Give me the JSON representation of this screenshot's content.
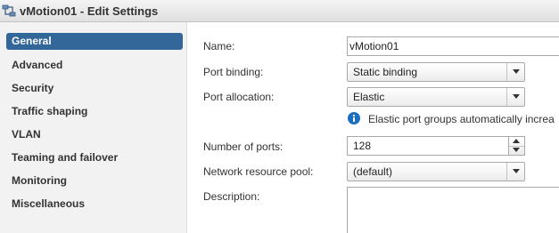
{
  "window": {
    "title": "vMotion01 - Edit Settings"
  },
  "sidebar": {
    "items": [
      {
        "label": "General"
      },
      {
        "label": "Advanced"
      },
      {
        "label": "Security"
      },
      {
        "label": "Traffic shaping"
      },
      {
        "label": "VLAN"
      },
      {
        "label": "Teaming and failover"
      },
      {
        "label": "Monitoring"
      },
      {
        "label": "Miscellaneous"
      }
    ]
  },
  "form": {
    "name_label": "Name:",
    "name_value": "vMotion01",
    "port_binding_label": "Port binding:",
    "port_binding_value": "Static binding",
    "port_allocation_label": "Port allocation:",
    "port_allocation_value": "Elastic",
    "info_text": "Elastic port groups automatically increa",
    "num_ports_label": "Number of ports:",
    "num_ports_value": "128",
    "resource_pool_label": "Network resource pool:",
    "resource_pool_value": "(default)",
    "description_label": "Description:"
  },
  "colors": {
    "selected_nav_bg": "#336699",
    "info_icon": "#1a6fc1"
  }
}
